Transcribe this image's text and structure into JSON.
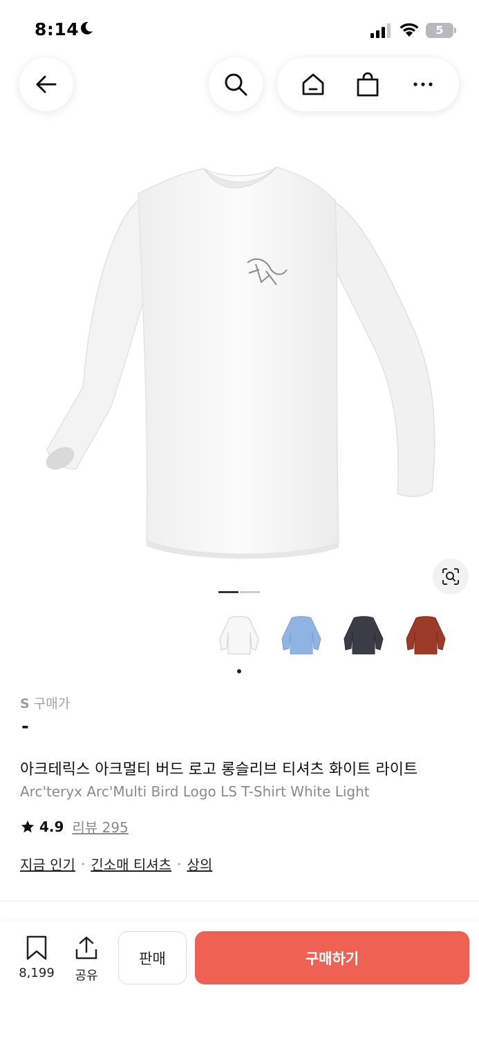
{
  "status_bar": {
    "time": "8:14",
    "battery": "5"
  },
  "nav": {
    "icons": [
      "back-arrow-icon",
      "search-icon",
      "home-icon",
      "shopping-bag-icon",
      "more-icon"
    ]
  },
  "product": {
    "image_count": 2,
    "active_image": 1,
    "thumbnails": [
      "white",
      "light-blue",
      "charcoal",
      "rust-red"
    ],
    "thumbnail_colors": [
      "#f5f5f5",
      "#8fb4e3",
      "#3a3d45",
      "#9c3b27"
    ],
    "size_label": "S",
    "price_label": "구매가",
    "price_value": "-",
    "title_ko": "아크테릭스 아크멀티 버드 로고 롱슬리브 티셔츠 화이트 라이트",
    "title_en": "Arc'teryx Arc'Multi Bird Logo LS T-Shirt White Light",
    "rating": "4.9",
    "reviews_label": "리뷰 295",
    "tags": [
      "지금 인기",
      "긴소매 티셔츠",
      "상의"
    ],
    "tag_separator": "·"
  },
  "bottom_bar": {
    "wish_count": "8,199",
    "share_label": "공유",
    "sell_label": "판매",
    "buy_label": "구매하기"
  },
  "colors": {
    "buy_button": "#ef6253"
  }
}
